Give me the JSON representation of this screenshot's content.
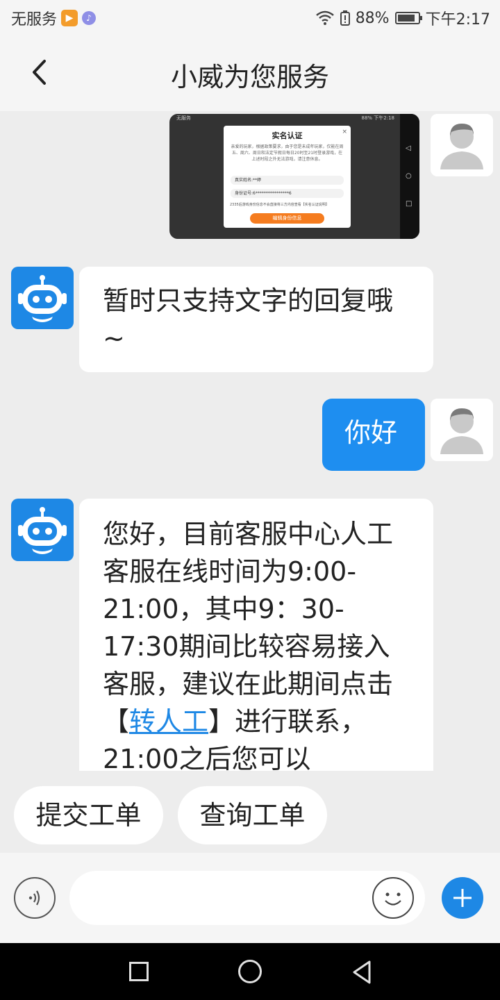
{
  "status_bar": {
    "carrier": "无服务",
    "battery_percent": "88%",
    "time": "下午2:17",
    "battery_level": 0.88
  },
  "header": {
    "title": "小威为您服务"
  },
  "messages": [
    {
      "type": "image",
      "sender": "user",
      "screenshot": {
        "status_left": "无服务",
        "status_right": "88% 下午2:18",
        "dialog_title": "实名认证",
        "dialog_close": "×",
        "dialog_body": "亲爱的玩家，根据政策要求，由于您是未成年玩家，仅能在周五、周六、周日和法定节假日每日20时至21时登录游戏，在上述时段之外无法游戏，请注意休息。",
        "name_field": "真实姓名:**婷",
        "id_field": "身份证号:6****************6",
        "note": "2335后游戏身份信息不会直接将三方内容查看【实名认证说明】",
        "button": "编辑身份信息"
      }
    },
    {
      "type": "text",
      "sender": "bot",
      "text": "暂时只支持文字的回复哦~"
    },
    {
      "type": "text",
      "sender": "user",
      "text": "你好"
    },
    {
      "type": "text",
      "sender": "bot",
      "part1": "您好，目前客服中心人工客服在线时间为9:00-21:00，其中9：30-17:30期间比较容易接入客服，建议在此期间点击【",
      "link": "转人工",
      "part2": "】进行联系，21:00之后您可以"
    }
  ],
  "quick_replies": [
    "提交工单",
    "查询工单"
  ],
  "input_bar": {
    "placeholder": ""
  },
  "icons": {
    "back": "chevron-left-icon",
    "voice": "voice-icon",
    "emoji": "smiley-icon",
    "plus": "plus-icon"
  },
  "colors": {
    "accent": "#1e88e5",
    "user_bubble": "#1e8ef0",
    "background": "#ededed"
  }
}
